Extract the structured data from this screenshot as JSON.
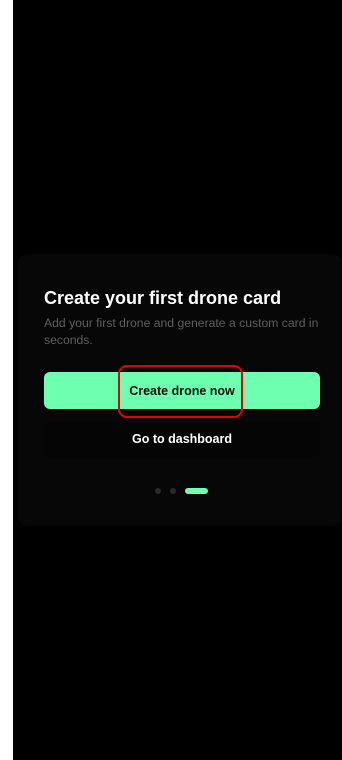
{
  "onboarding": {
    "title": "Create your first drone card",
    "subtitle": "Add your first drone and generate a custom card in seconds.",
    "primary_button_label": "Create drone now",
    "secondary_button_label": "Go to dashboard",
    "pagination": {
      "total": 3,
      "current": 3
    }
  },
  "colors": {
    "background": "#000000",
    "accent": "#6effb0",
    "highlight": "#e60000"
  }
}
